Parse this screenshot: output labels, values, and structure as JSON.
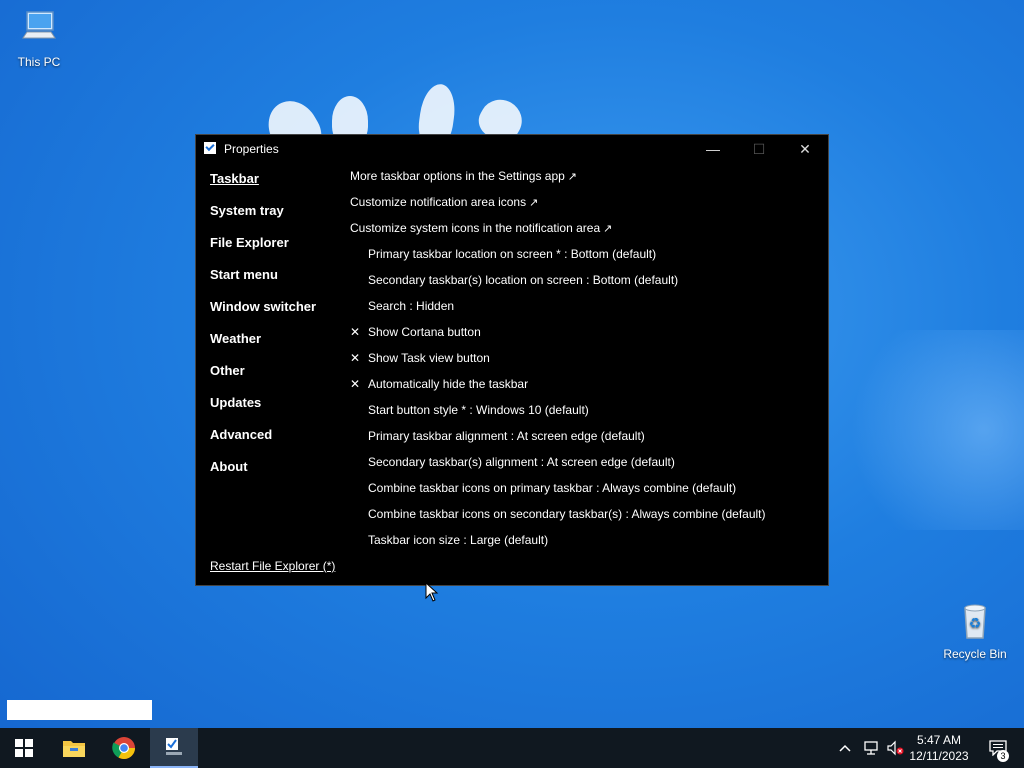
{
  "desktop": {
    "this_pc_label": "This PC",
    "recycle_bin_label": "Recycle Bin"
  },
  "window": {
    "title": "Properties",
    "controls": {
      "minimize": "—",
      "maximize": "☐",
      "close": "✕"
    },
    "nav": [
      {
        "label": "Taskbar",
        "active": true
      },
      {
        "label": "System tray"
      },
      {
        "label": "File Explorer"
      },
      {
        "label": "Start menu"
      },
      {
        "label": "Window switcher"
      },
      {
        "label": "Weather"
      },
      {
        "label": "Other"
      },
      {
        "label": "Updates"
      },
      {
        "label": "Advanced"
      },
      {
        "label": "About"
      }
    ],
    "restart_link": "Restart File Explorer (*)",
    "links": [
      "More taskbar options in the Settings app",
      "Customize notification area icons",
      "Customize system icons in the notification area"
    ],
    "link_arrow": "↗",
    "options": [
      {
        "label": "Primary taskbar location on screen * : Bottom (default)",
        "mark": ""
      },
      {
        "label": "Secondary taskbar(s) location on screen : Bottom (default)",
        "mark": ""
      },
      {
        "label": "Search : Hidden",
        "mark": ""
      },
      {
        "label": "Show Cortana button",
        "mark": "✕"
      },
      {
        "label": "Show Task view button",
        "mark": "✕"
      },
      {
        "label": "Automatically hide the taskbar",
        "mark": "✕"
      },
      {
        "label": "Start button style * : Windows 10 (default)",
        "mark": ""
      },
      {
        "label": "Primary taskbar alignment : At screen edge (default)",
        "mark": ""
      },
      {
        "label": "Secondary taskbar(s) alignment : At screen edge (default)",
        "mark": ""
      },
      {
        "label": "Combine taskbar icons on primary taskbar : Always combine (default)",
        "mark": ""
      },
      {
        "label": "Combine taskbar icons on secondary taskbar(s) : Always combine (default)",
        "mark": ""
      },
      {
        "label": "Taskbar icon size : Large (default)",
        "mark": ""
      }
    ]
  },
  "taskbar": {
    "clock_time": "5:47 AM",
    "clock_date": "12/11/2023",
    "notification_count": "3"
  },
  "colors": {
    "accent": "#1a6fd8",
    "window_bg": "#000000",
    "taskbar_bg": "#101820"
  }
}
